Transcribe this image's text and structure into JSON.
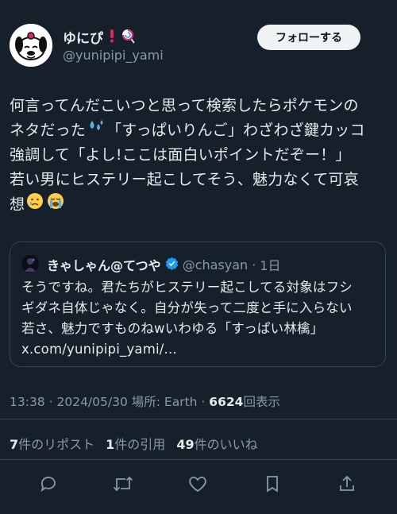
{
  "author": {
    "display_name": "ゆにぴ",
    "handle": "@yunipipi_yami",
    "name_emoji_1": "exclamation-icon",
    "name_emoji_2": "lollipop-icon"
  },
  "follow_button": {
    "label": "フォローする"
  },
  "tweet": {
    "lines": [
      "何言ってんだこいつと思って検索したらポケモンの",
      "ネタだった",
      "「すっぱいりんご」わざわざ鍵カッコ",
      "強調して「よし!ここは面白いポイントだぞー！」",
      "若い男にヒステリー起こしてそう、魅力なくて可哀",
      "想"
    ],
    "emojis": [
      "sweat-droplets-icon",
      "crying-face-icon",
      "loudly-crying-face-icon"
    ]
  },
  "quote": {
    "name": "きゃしゃん@てつや",
    "handle": "@chasyan",
    "separator": "·",
    "time": "1日",
    "lines": [
      "そうですね。君たちがヒステリー起こしてる対象はフシ",
      "ギダネ自体じゃなく。自分が失って二度と手に入らない",
      "若さ、魅力ですものねwいわゆる「すっぱい林檎」",
      "x.com/yunipipi_yami/..."
    ]
  },
  "meta": {
    "time": "13:38",
    "sep1": "·",
    "date": "2024/05/30",
    "location": "場所: Earth",
    "sep2": "·",
    "views": "6624",
    "views_label": "回表示"
  },
  "stats": {
    "reposts": "7",
    "reposts_label": "件のリポスト",
    "quotes": "1",
    "quotes_label": "件の引用",
    "likes": "49",
    "likes_label": "件のいいね"
  },
  "actions": [
    "reply-icon",
    "repost-icon",
    "like-icon",
    "bookmark-icon",
    "share-icon"
  ],
  "colors": {
    "background": "#15202b",
    "text": "#e7e9ea",
    "secondary": "#8b98a5",
    "border": "#38444d",
    "verified": "#1d9bf0"
  }
}
